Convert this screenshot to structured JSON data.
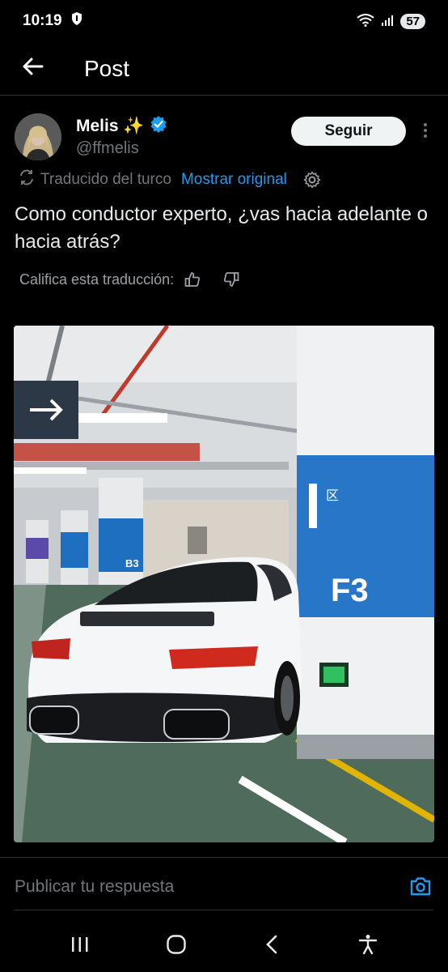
{
  "status_bar": {
    "time": "10:19",
    "battery": "57"
  },
  "header": {
    "title": "Post"
  },
  "author": {
    "name": "Melis ✨",
    "handle": "@ffmelis",
    "follow_label": "Seguir"
  },
  "translation": {
    "label": "Traducido del turco",
    "show_original": "Mostrar original"
  },
  "post": {
    "text": "Como conductor experto, ¿vas hacia adelante o hacia atrás?"
  },
  "rating": {
    "label": "Califica esta traducción:"
  },
  "media": {
    "pillar_label": "F3",
    "pillar_label_back": "B3"
  },
  "reply": {
    "placeholder": "Publicar tu respuesta"
  },
  "colors": {
    "accent": "#1d9bf0",
    "verified": "#1d9bf0",
    "background": "#000000"
  }
}
